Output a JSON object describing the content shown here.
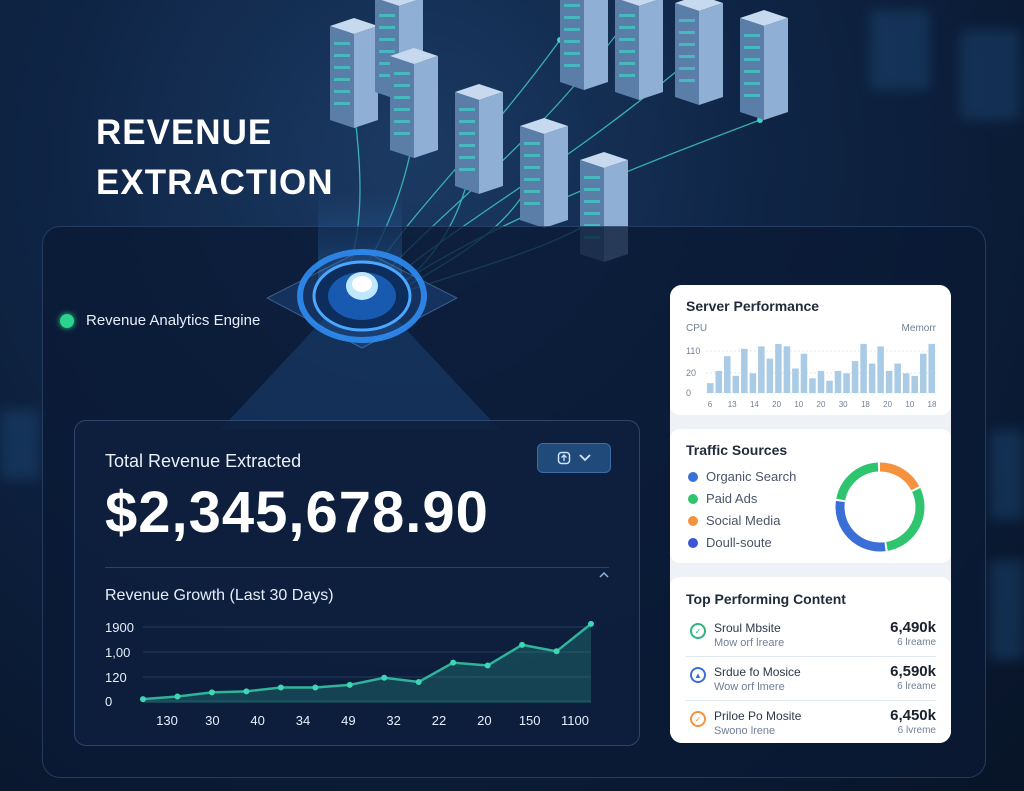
{
  "hero": {
    "title_line1": "REVENUE",
    "title_line2": "EXTRACTION"
  },
  "engine": {
    "label": "Revenue Analytics Engine",
    "status_color": "#2ad48d"
  },
  "revenue": {
    "label": "Total Revenue Extracted",
    "value": "$2,345,678.90",
    "toggle_icon": "shield-icon",
    "toggle_chevron": "chevron-down-icon"
  },
  "growth_chart": {
    "title": "Revenue Growth (Last 30 Days)",
    "y_ticks": [
      "1900",
      "1,00",
      "120",
      "0"
    ],
    "x_ticks": [
      "130",
      "30",
      "40",
      "34",
      "49",
      "32",
      "22",
      "20",
      "150",
      "1100"
    ]
  },
  "server_performance": {
    "title": "Server Performance",
    "left_label": "CPU",
    "right_label": "Memorr",
    "y_ticks": [
      "110",
      "20",
      "0"
    ],
    "x_ticks": [
      "6",
      "13",
      "14",
      "20",
      "10",
      "20",
      "30",
      "18",
      "20",
      "10",
      "18"
    ]
  },
  "traffic_sources": {
    "title": "Traffic Sources",
    "items": [
      {
        "label": "Organic Search",
        "color": "#3b6fd8"
      },
      {
        "label": "Paid Ads",
        "color": "#2fc46e"
      },
      {
        "label": "Social Media",
        "color": "#f5923e"
      },
      {
        "label": "Doull-soute",
        "color": "#3b55d8"
      }
    ]
  },
  "top_content": {
    "title": "Top Performing Content",
    "rows": [
      {
        "name": "Sroul Mbsite",
        "sub": "Mow orf lreare",
        "value": "6,490k",
        "value_sub": "6 lreame",
        "icon": "check-icon",
        "icon_color": "#2fb37f"
      },
      {
        "name": "Srdue fo Mosice",
        "sub": "Wow orf lmere",
        "value": "6,590k",
        "value_sub": "6 lreame",
        "icon": "shield-icon",
        "icon_color": "#3b6fd8"
      },
      {
        "name": "Priloe Po Mosite",
        "sub": "Swono lrene",
        "value": "6,450k",
        "value_sub": "6 lvreme",
        "icon": "check-icon",
        "icon_color": "#f5923e"
      }
    ]
  },
  "chart_data": [
    {
      "type": "line",
      "title": "Revenue Growth (Last 30 Days)",
      "x": [
        "130",
        "30",
        "40",
        "34",
        "49",
        "32",
        "22",
        "20",
        "150",
        "1100"
      ],
      "y_ticks": [
        "0",
        "120",
        "1,00",
        "1900"
      ],
      "series": [
        {
          "values": [
            120,
            200,
            330,
            360,
            480,
            480,
            560,
            780,
            650,
            1250,
            1160,
            1800,
            1600,
            2450
          ]
        }
      ],
      "ylim": [
        0,
        2600
      ],
      "grid": true
    },
    {
      "type": "bar",
      "title": "Server Performance",
      "xlabel": "",
      "ylabel": "CPU",
      "x": [
        "6",
        "13",
        "14",
        "20",
        "10",
        "20",
        "30",
        "18",
        "20",
        "10",
        "18"
      ],
      "values": [
        20,
        45,
        75,
        35,
        90,
        40,
        95,
        70,
        100,
        95,
        50,
        80,
        30,
        45,
        25,
        45,
        40,
        65,
        100,
        60,
        95,
        45,
        60,
        40,
        35,
        80,
        100
      ],
      "ylim": [
        0,
        110
      ],
      "grid": true
    },
    {
      "type": "pie",
      "title": "Traffic Sources",
      "categories": [
        "Organic Search",
        "Paid Ads",
        "Social Media",
        "Doull-soute"
      ],
      "values": [
        30,
        30,
        18,
        22
      ]
    }
  ],
  "colors": {
    "accent_teal": "#2fb39a",
    "bar_blue": "#a9cbe6",
    "panel_bg": "#0e2446"
  }
}
